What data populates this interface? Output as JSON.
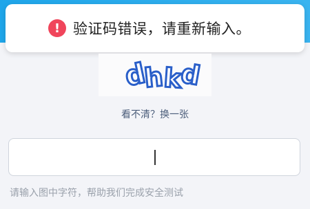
{
  "toast": {
    "icon": "exclamation-icon",
    "message": "验证码错误，请重新输入。",
    "accent": "#f0455b"
  },
  "captcha": {
    "text": "dhkd"
  },
  "refresh": {
    "label": "看不清？换一张"
  },
  "input": {
    "value": "",
    "placeholder": ""
  },
  "hint": {
    "text": "请输入图中字符，帮助我们完成安全测试"
  },
  "colors": {
    "header": "#1fa6ea",
    "captcha_ink": "#2a5ec9",
    "link": "#4b5d7a"
  }
}
